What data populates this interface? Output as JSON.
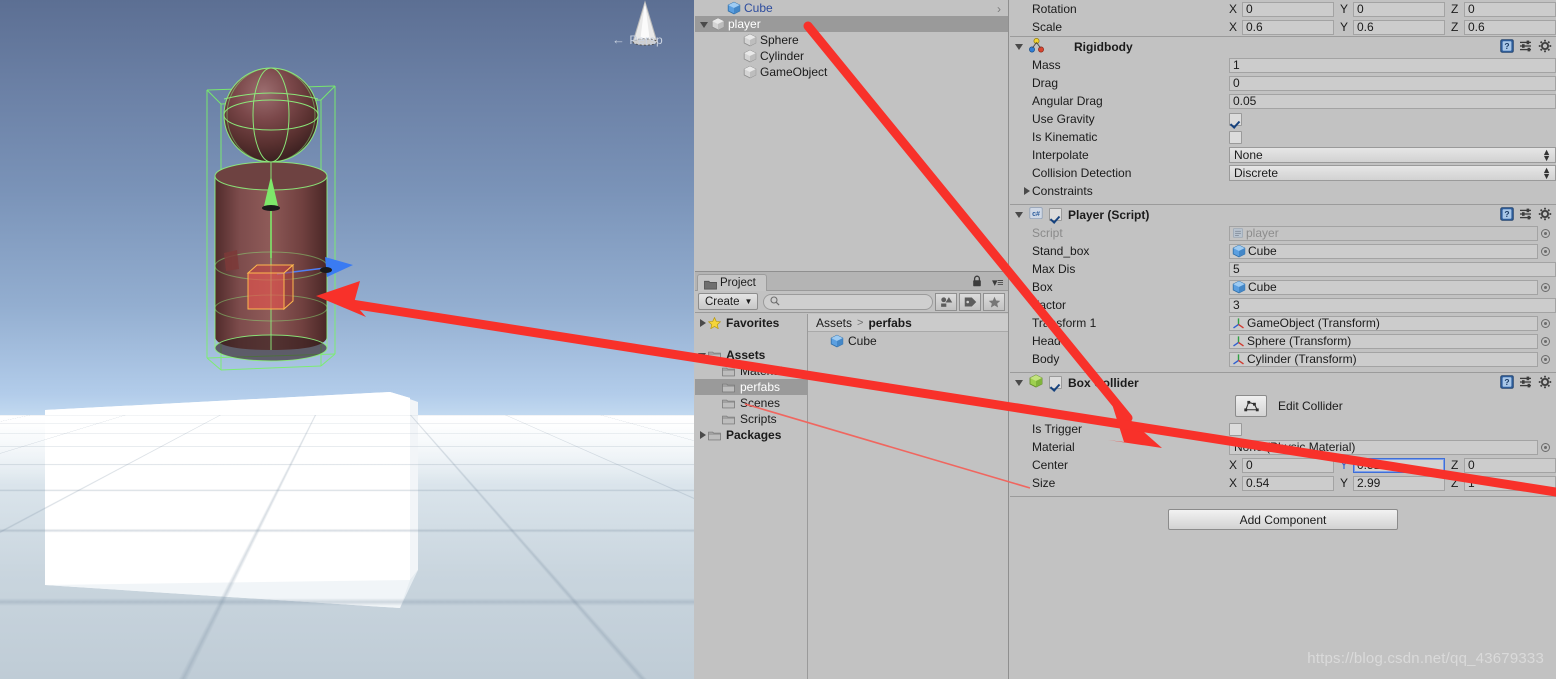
{
  "scene": {
    "view_mode": "Persp",
    "watermark": "https://blog.csdn.net/qq_43679333"
  },
  "hierarchy": {
    "items": [
      {
        "label": "Cube",
        "indent": 1,
        "icon": "prefab-cube-icon",
        "prefab": true,
        "selected": false,
        "expander": "none",
        "has_overflow_arrow": true
      },
      {
        "label": "player",
        "indent": 0,
        "icon": "gameobject-cube-icon",
        "prefab": false,
        "selected": true,
        "expander": "open",
        "has_overflow_arrow": false
      },
      {
        "label": "Sphere",
        "indent": 2,
        "icon": "gameobject-cube-icon",
        "prefab": false,
        "selected": false,
        "expander": "none",
        "has_overflow_arrow": false
      },
      {
        "label": "Cylinder",
        "indent": 2,
        "icon": "gameobject-cube-icon",
        "prefab": false,
        "selected": false,
        "expander": "none",
        "has_overflow_arrow": false
      },
      {
        "label": "GameObject",
        "indent": 2,
        "icon": "gameobject-cube-icon",
        "prefab": false,
        "selected": false,
        "expander": "none",
        "has_overflow_arrow": false
      }
    ]
  },
  "project": {
    "tab_label": "Project",
    "create_label": "Create",
    "search_placeholder": "",
    "search_value": "",
    "tree": [
      {
        "label": "Favorites",
        "expander": "closed",
        "icon": "star-icon",
        "bold": true,
        "indent": 0,
        "selected": false
      },
      {
        "label": "",
        "expander": "none",
        "icon": "none",
        "bold": false,
        "indent": 0,
        "selected": false
      },
      {
        "label": "Assets",
        "expander": "open",
        "icon": "folder-icon",
        "bold": true,
        "indent": 0,
        "selected": false
      },
      {
        "label": "Material",
        "expander": "none",
        "icon": "folder-icon",
        "bold": false,
        "indent": 1,
        "selected": false
      },
      {
        "label": "perfabs",
        "expander": "none",
        "icon": "folder-icon",
        "bold": false,
        "indent": 1,
        "selected": true
      },
      {
        "label": "Scenes",
        "expander": "none",
        "icon": "folder-icon",
        "bold": false,
        "indent": 1,
        "selected": false
      },
      {
        "label": "Scripts",
        "expander": "none",
        "icon": "folder-icon",
        "bold": false,
        "indent": 1,
        "selected": false
      },
      {
        "label": "Packages",
        "expander": "closed",
        "icon": "folder-icon",
        "bold": true,
        "indent": 0,
        "selected": false
      }
    ],
    "breadcrumb": {
      "root": "Assets",
      "separator": ">",
      "current": "perfabs"
    },
    "content_items": [
      {
        "label": "Cube",
        "icon": "prefab-cube-icon"
      }
    ]
  },
  "inspector": {
    "transform_rows": [
      {
        "label": "Rotation",
        "x": "0",
        "y": "0",
        "z": "0"
      },
      {
        "label": "Scale",
        "x": "0.6",
        "y": "0.6",
        "z": "0.6"
      }
    ],
    "rigidbody": {
      "title": "Rigidbody",
      "enabled_checkbox": false,
      "mass_label": "Mass",
      "mass_value": "1",
      "drag_label": "Drag",
      "drag_value": "0",
      "angular_drag_label": "Angular Drag",
      "angular_drag_value": "0.05",
      "use_gravity_label": "Use Gravity",
      "use_gravity_value": true,
      "is_kinematic_label": "Is Kinematic",
      "is_kinematic_value": false,
      "interpolate_label": "Interpolate",
      "interpolate_value": "None",
      "collision_detection_label": "Collision Detection",
      "collision_detection_value": "Discrete",
      "constraints_label": "Constraints"
    },
    "player_script": {
      "title": "Player (Script)",
      "enabled": true,
      "fields": [
        {
          "label": "Script",
          "value": "player",
          "type": "object",
          "readonly": true,
          "icon": "script-icon"
        },
        {
          "label": "Stand_box",
          "value": "Cube",
          "type": "object",
          "readonly": false,
          "icon": "prefab-cube-icon"
        },
        {
          "label": "Max Dis",
          "value": "5",
          "type": "text",
          "readonly": false,
          "icon": "none"
        },
        {
          "label": "Box",
          "value": "Cube",
          "type": "object",
          "readonly": false,
          "icon": "prefab-cube-icon"
        },
        {
          "label": "Factor",
          "value": "3",
          "type": "text",
          "readonly": false,
          "icon": "none"
        },
        {
          "label": "Transform 1",
          "value": "GameObject (Transform)",
          "type": "object",
          "readonly": false,
          "icon": "transform-icon"
        },
        {
          "label": "Head",
          "value": "Sphere (Transform)",
          "type": "object",
          "readonly": false,
          "icon": "transform-icon"
        },
        {
          "label": "Body",
          "value": "Cylinder (Transform)",
          "type": "object",
          "readonly": false,
          "icon": "transform-icon"
        }
      ]
    },
    "box_collider": {
      "title": "Box Collider",
      "enabled": true,
      "edit_collider_label": "Edit Collider",
      "is_trigger_label": "Is Trigger",
      "is_trigger_value": false,
      "material_label": "Material",
      "material_value": "None (Physic Material)",
      "center_label": "Center",
      "center": {
        "x": "0",
        "y": "0.51",
        "z": "0"
      },
      "center_focused_axis": "Y",
      "size_label": "Size",
      "size": {
        "x": "0.54",
        "y": "2.99",
        "z": "1"
      }
    },
    "add_component_label": "Add Component"
  },
  "colors": {
    "panel_bg": "#c2c2c2",
    "selection": "#9a9a9a",
    "prefab_blue": "#2d4c9e",
    "annotation_red": "#f8312a",
    "focus_blue": "#3f6fd8"
  }
}
